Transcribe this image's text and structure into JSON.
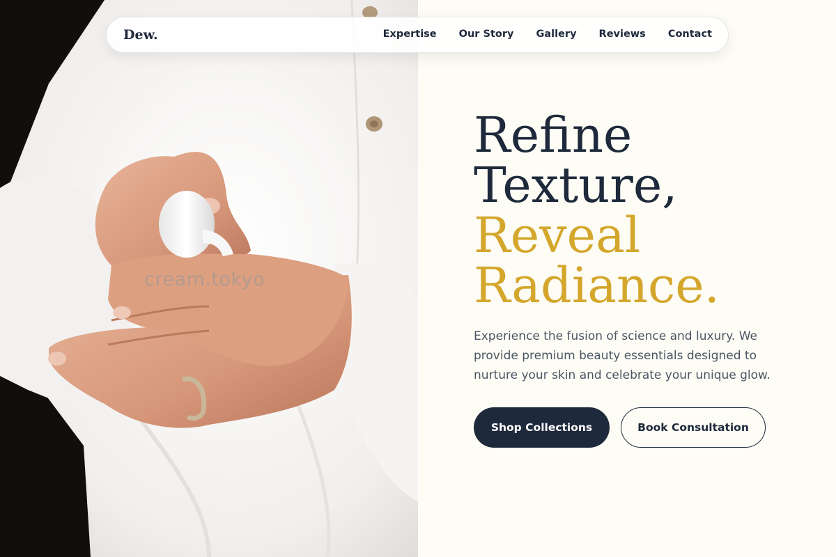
{
  "nav": {
    "logo": "Dew.",
    "links": [
      "Expertise",
      "Our Story",
      "Gallery",
      "Reviews",
      "Contact"
    ]
  },
  "hero": {
    "line1": "Refine",
    "line2": "Texture,",
    "line3": "Reveal",
    "line4": "Radiance.",
    "subtitle": "Experience the fusion of science and luxury. We provide premium beauty essentials designed to nurture your skin and celebrate your unique glow.",
    "primary_cta": "Shop Collections",
    "secondary_cta": "Book Consultation"
  },
  "image": {
    "description": "hands-applying-lotion-photo",
    "watermark": "cream.tokyo"
  },
  "colors": {
    "navy": "#1e293b",
    "gold": "#d4a72c",
    "cream_background": "#fdfcf5",
    "body_text": "#4b5563"
  }
}
